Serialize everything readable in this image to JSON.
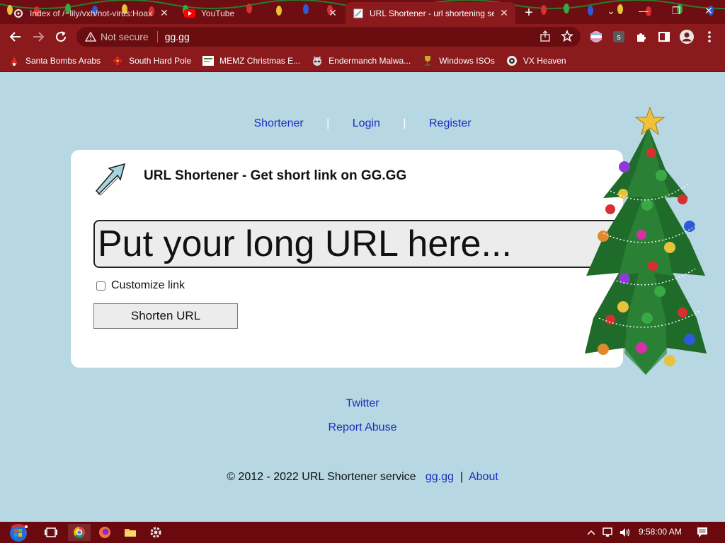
{
  "browser": {
    "tabs": [
      {
        "title": "Index of /~lily/vxh/not-virus:Hoax",
        "active": false
      },
      {
        "title": "YouTube",
        "active": false
      },
      {
        "title": "URL Shortener - url shortening se",
        "active": true
      }
    ],
    "new_tab_label": "+",
    "window_controls": {
      "tab_search": "⌄",
      "minimize": "—",
      "restore": "❐",
      "close": "✕"
    },
    "address_bar": {
      "security_label": "Not secure",
      "url": "gg.gg"
    },
    "bookmarks": [
      {
        "label": "Santa Bombs Arabs",
        "icon": "santa-icon"
      },
      {
        "label": "South Hard Pole",
        "icon": "flower-icon"
      },
      {
        "label": "MEMZ Christmas E...",
        "icon": "memz-icon"
      },
      {
        "label": "Endermanch Malwa...",
        "icon": "raccoon-icon"
      },
      {
        "label": "Windows ISOs",
        "icon": "trophy-icon"
      },
      {
        "label": "VX Heaven",
        "icon": "vx-icon"
      }
    ]
  },
  "page": {
    "nav": {
      "shortener": "Shortener",
      "login": "Login",
      "register": "Register",
      "separator": "|"
    },
    "card": {
      "title": "URL Shortener - Get short link on GG.GG",
      "url_placeholder": "Put your long URL here...",
      "customize_label": "Customize link",
      "shorten_button": "Shorten URL"
    },
    "links": {
      "twitter": "Twitter",
      "report_abuse": "Report Abuse"
    },
    "footer": {
      "copyright": "© 2012 - 2022 URL Shortener service",
      "site_link": "gg.gg",
      "separator": "|",
      "about_link": "About"
    }
  },
  "taskbar": {
    "clock": "9:58:00 AM"
  },
  "colors": {
    "tabstrip": "#6e0e12",
    "toolbar": "#8b1a1d",
    "page_background": "#b7d7e3",
    "link": "#1a2fbf",
    "taskbar": "#6a0a0e"
  }
}
